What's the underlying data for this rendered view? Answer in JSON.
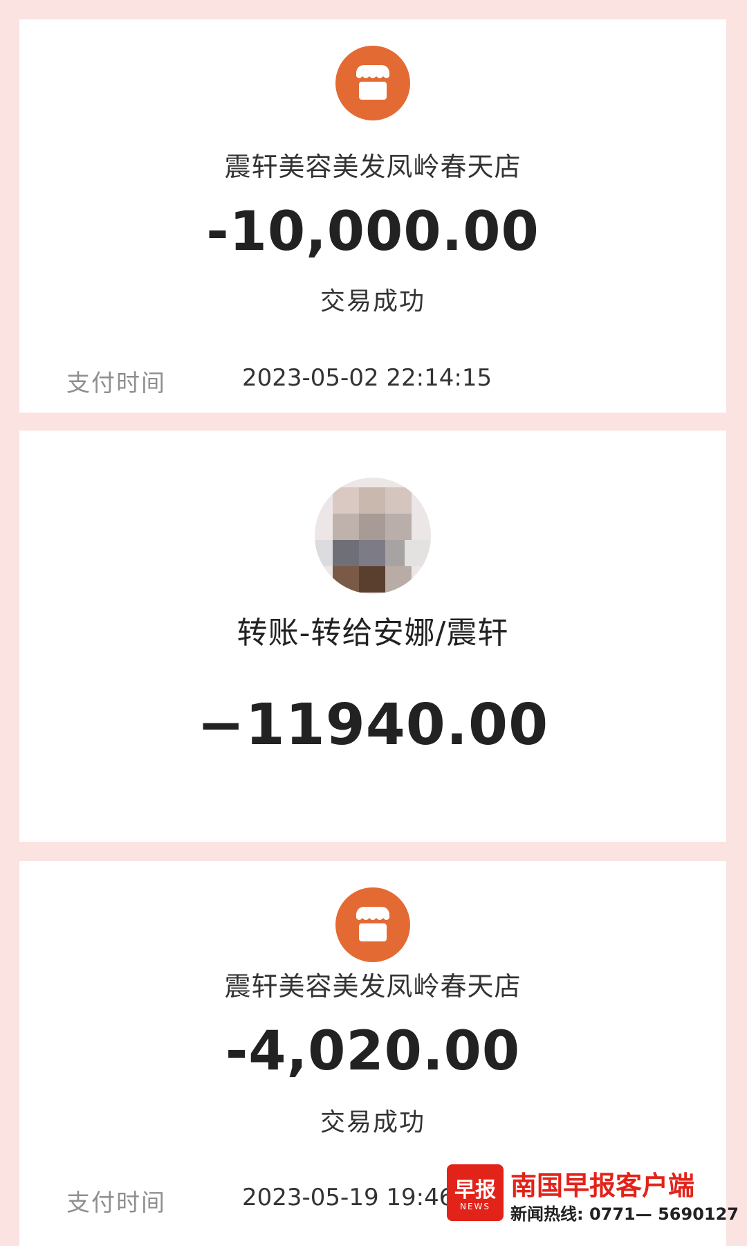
{
  "cards": [
    {
      "icon": "shop-icon",
      "merchant": "震轩美容美发凤岭春天店",
      "amount": "-10,000.00",
      "status": "交易成功",
      "time_label": "支付时间",
      "time_value": "2023-05-02 22:14:15"
    },
    {
      "icon": "blurred-avatar",
      "merchant": "转账-转给安娜/震轩",
      "amount": "−11940.00"
    },
    {
      "icon": "shop-icon",
      "merchant": "震轩美容美发凤岭春天店",
      "amount": "-4,020.00",
      "status": "交易成功",
      "time_label": "支付时间",
      "time_value": "2023-05-19 19:46:"
    }
  ],
  "watermark": {
    "logo_text": "早报",
    "logo_sub": "NEWS",
    "name": "南国早报客户端",
    "hotline": "新闻热线: 0771— 5690127"
  },
  "colors": {
    "page_bg": "#fbe3e2",
    "shop_icon": "#e46a34",
    "brand_red": "#e2231a"
  }
}
